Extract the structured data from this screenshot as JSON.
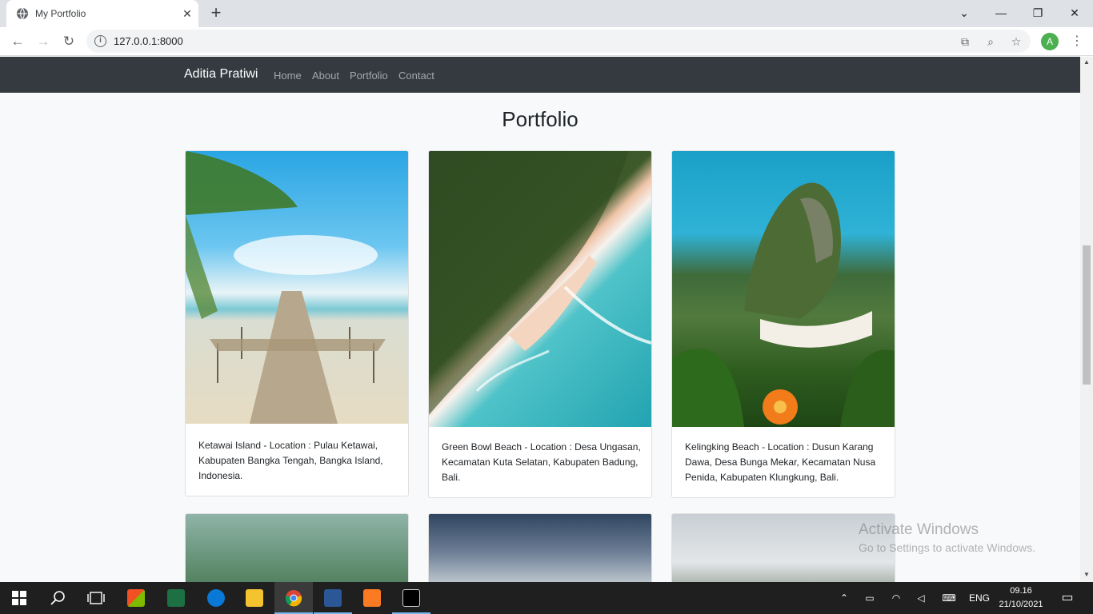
{
  "browser": {
    "tab_title": "My Portfolio",
    "tab_close": "✕",
    "new_tab": "+",
    "url": "127.0.0.1:8000",
    "window_controls": [
      "⌄",
      "—",
      "❐",
      "✕"
    ],
    "avatar_letter": "A"
  },
  "navbar": {
    "brand": "Aditia Pratiwi",
    "links": [
      "Home",
      "About",
      "Portfolio",
      "Contact"
    ]
  },
  "main": {
    "title": "Portfolio",
    "cards": [
      {
        "text": "Ketawai Island - Location : Pulau Ketawai, Kabupaten Bangka Tengah, Bangka Island, Indonesia."
      },
      {
        "text": "Green Bowl Beach - Location : Desa Ungasan, Kecamatan Kuta Selatan, Kabupaten Badung, Bali."
      },
      {
        "text": "Kelingking Beach - Location : Dusun Karang Dawa, Desa Bunga Mekar, Kecamatan Nusa Penida, Kabupaten Klungkung, Bali."
      }
    ]
  },
  "watermark": {
    "line1": "Activate Windows",
    "line2": "Go to Settings to activate Windows."
  },
  "taskbar": {
    "language": "ENG",
    "time": "09.16",
    "date": "21/10/2021"
  },
  "colors": {
    "navbar_bg": "#343a40",
    "page_bg": "#f8f9fa",
    "taskbar_bg": "#1f1f1f"
  }
}
